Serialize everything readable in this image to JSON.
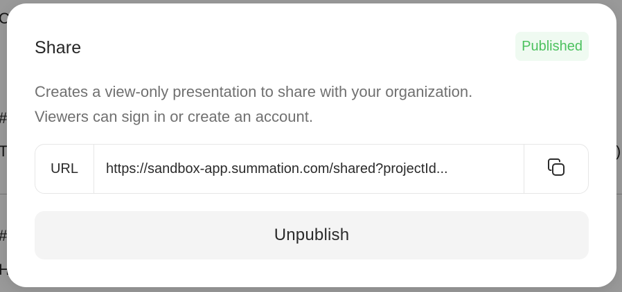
{
  "background": {
    "fragments": [
      "C",
      "#",
      "T",
      ")",
      "#",
      "H"
    ]
  },
  "modal": {
    "title": "Share",
    "status_badge": "Published",
    "description_line1": "Creates a view-only presentation to share with your organization.",
    "description_line2": "Viewers can sign in or create an account.",
    "url_label": "URL",
    "url_value": "https://sandbox-app.summation.com/shared?projectId...",
    "copy_icon": "copy-icon",
    "unpublish_label": "Unpublish"
  },
  "colors": {
    "badge_text": "#4cc15e",
    "badge_bg": "#effaf1",
    "button_bg": "#f4f4f4"
  }
}
